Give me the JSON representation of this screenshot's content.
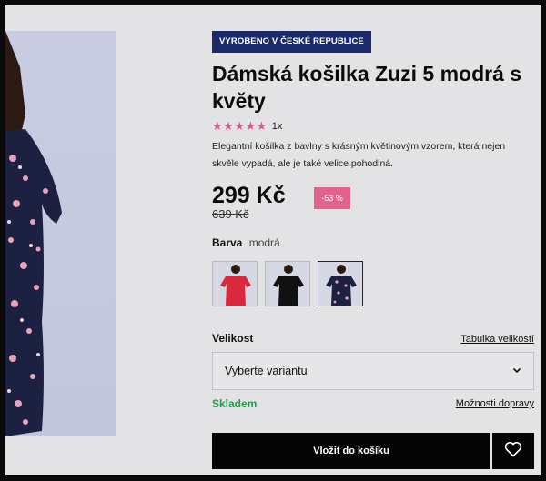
{
  "product": {
    "badge": "VYROBENO V ČESKÉ REPUBLICE",
    "title": "Dámská košilka Zuzi 5 modrá s květy",
    "rating": {
      "stars": 5,
      "count_label": "1x"
    },
    "description": "Elegantní košilka z bavlny s krásným květinovým vzorem, která nejen skvěle vypadá, ale je také velice pohodlná.",
    "price": "299 Kč",
    "old_price": "639 Kč",
    "discount": "-53 %"
  },
  "color": {
    "label": "Barva",
    "value": "modrá",
    "swatches": [
      {
        "name": "red",
        "color": "#d9293c"
      },
      {
        "name": "black",
        "color": "#111111"
      },
      {
        "name": "navy-floral",
        "color": "#1c2142"
      }
    ],
    "selected_index": 2
  },
  "size": {
    "label": "Velikost",
    "size_table_link": "Tabulka velikostí",
    "select_placeholder": "Vyberte variantu"
  },
  "availability": {
    "stock": "Skladem",
    "shipping_link": "Možnosti dopravy"
  },
  "actions": {
    "add_to_cart": "Vložit do košíku",
    "wishlist_icon": "heart-icon"
  },
  "colors": {
    "badge_bg": "#1b2a6b",
    "stars": "#d85a89",
    "discount_bg": "#e3628d",
    "stock": "#1e9f4a",
    "button_bg": "#050505"
  }
}
